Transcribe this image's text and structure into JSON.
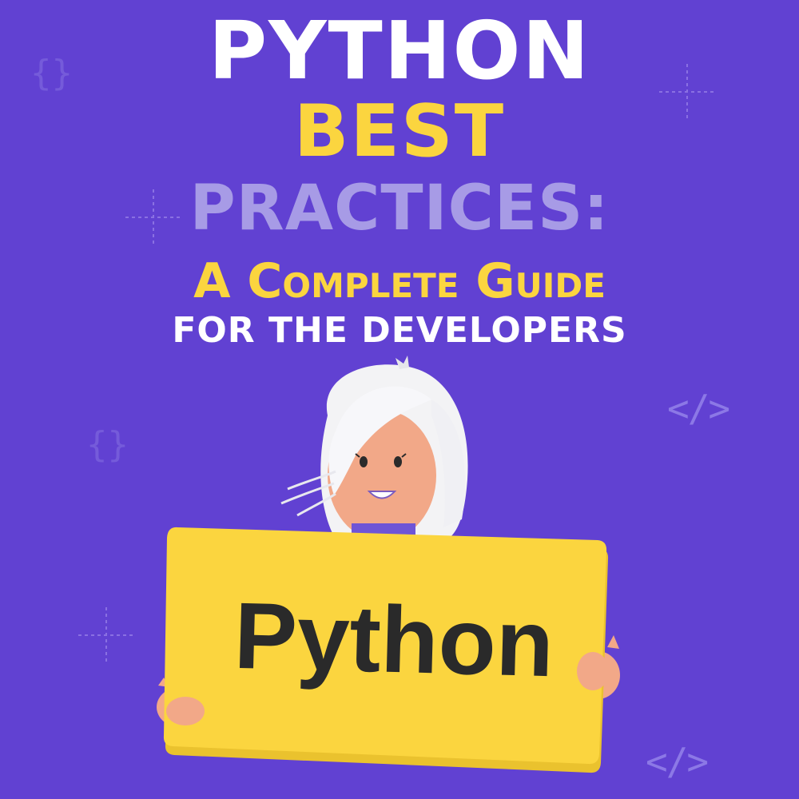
{
  "cover": {
    "title_line1": "PYTHON",
    "title_line2": "BEST",
    "title_line3": "PRACTICES:",
    "title_line4": "A Complete Guide",
    "title_line5": "FOR THE DEVELOPERS"
  },
  "sign": {
    "text": "Python"
  },
  "decorations": {
    "brace_symbol": "{}",
    "tag_symbol": "</>",
    "sparkle_icon": "sparkle-icon"
  },
  "colors": {
    "background": "#6141d2",
    "accent_yellow": "#fbd53f",
    "accent_lavender": "#a79be6",
    "white": "#ffffff",
    "sign_text": "#2a2a2a",
    "skin": "#f2a888"
  }
}
